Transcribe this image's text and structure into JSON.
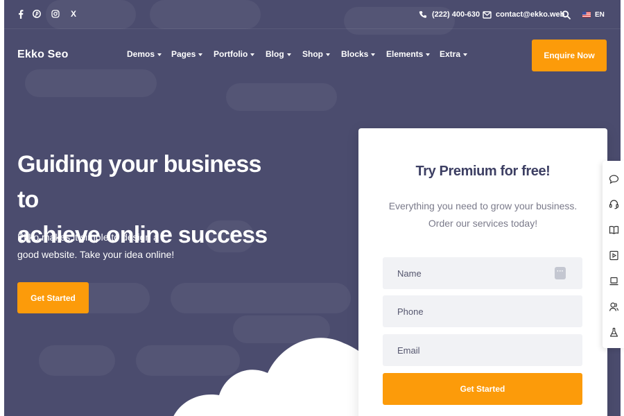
{
  "topbar": {
    "social": [
      {
        "icon": "facebook-icon"
      },
      {
        "icon": "pinterest-icon"
      },
      {
        "icon": "instagram-icon"
      },
      {
        "icon": "x-icon",
        "glyph": "X"
      }
    ],
    "phone": "(222) 400-630",
    "email": "contact@ekko.web",
    "language": "EN"
  },
  "nav": {
    "logo": "Ekko Seo",
    "items": [
      "Demos",
      "Pages",
      "Portfolio",
      "Blog",
      "Shop",
      "Blocks",
      "Elements",
      "Extra"
    ],
    "cta": "Enquire Now"
  },
  "hero": {
    "headline_line1": "Guiding your business to",
    "headline_line2": "achieve online success",
    "subtext": "Ekko makes it simple to design a good website. Take your idea online!",
    "cta": "Get Started"
  },
  "form": {
    "title": "Try Premium for free!",
    "subtitle_line1": "Everything you need to grow your business.",
    "subtitle_line2": "Order our services today!",
    "name_placeholder": "Name",
    "phone_placeholder": "Phone",
    "email_placeholder": "Email",
    "submit": "Get Started"
  },
  "toolbar": {
    "icons": [
      "chat-bubble-icon",
      "headset-icon",
      "book-icon",
      "video-icon",
      "laptop-icon",
      "users-icon",
      "flask-icon"
    ]
  },
  "colors": {
    "hero_bg": "#4b4c6e",
    "accent": "#fc9b0a",
    "title_text": "#3d3f63"
  }
}
